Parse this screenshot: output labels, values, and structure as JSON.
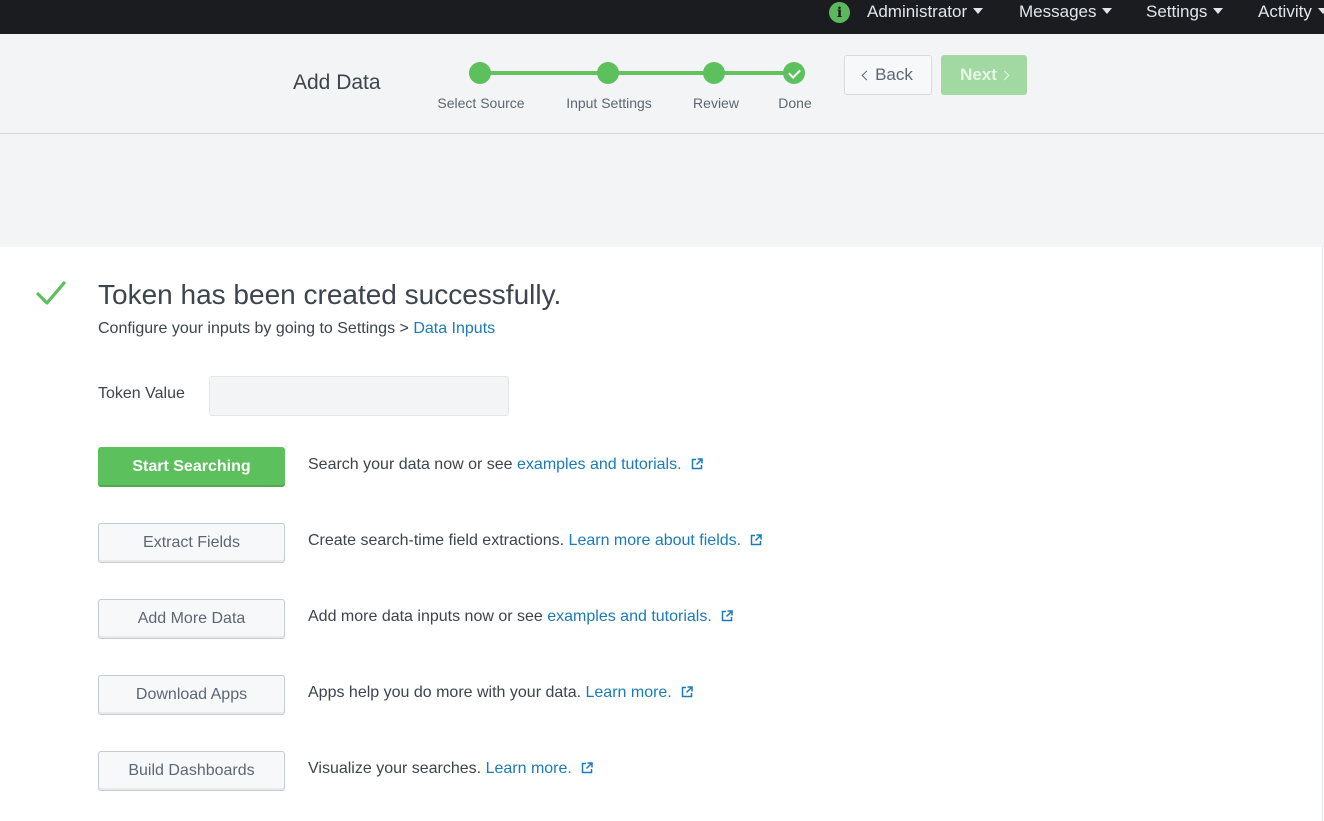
{
  "topnav": {
    "items": [
      {
        "label": "Administrator"
      },
      {
        "label": "Messages"
      },
      {
        "label": "Settings"
      },
      {
        "label": "Activity"
      }
    ]
  },
  "wizard": {
    "title": "Add Data",
    "steps": [
      {
        "label": "Select Source"
      },
      {
        "label": "Input Settings"
      },
      {
        "label": "Review"
      },
      {
        "label": "Done"
      }
    ],
    "back_label": "Back",
    "next_label": "Next"
  },
  "result": {
    "headline": "Token has been created successfully.",
    "subline_text": "Configure your inputs by going to Settings > ",
    "subline_link": "Data Inputs",
    "token_label": "Token Value",
    "token_value": ""
  },
  "actions": [
    {
      "button": "Start Searching",
      "text": "Search your data now or see ",
      "link": "examples and tutorials."
    },
    {
      "button": "Extract Fields",
      "text": "Create search-time field extractions. ",
      "link": "Learn more about fields."
    },
    {
      "button": "Add More Data",
      "text": "Add more data inputs now or see ",
      "link": "examples and tutorials."
    },
    {
      "button": "Download Apps",
      "text": "Apps help you do more with your data. ",
      "link": "Learn more."
    },
    {
      "button": "Build Dashboards",
      "text": "Visualize your searches. ",
      "link": "Learn more."
    }
  ],
  "colors": {
    "accent_green": "#5cc05c",
    "link_blue": "#1a7bb8",
    "topbar_bg": "#1a1c20"
  }
}
